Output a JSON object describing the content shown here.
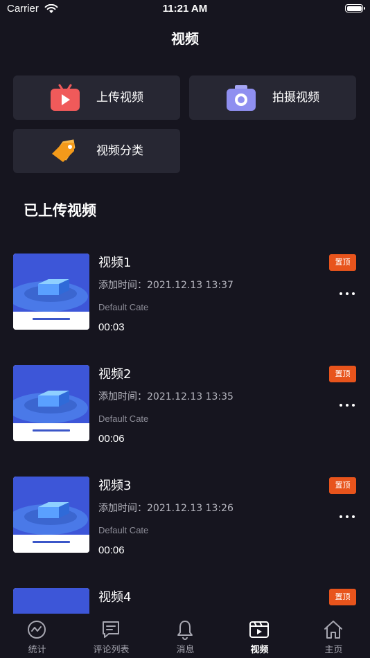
{
  "status_bar": {
    "carrier": "Carrier",
    "time": "11:21 AM",
    "wifi_icon": "wifi-icon",
    "battery_icon": "battery-icon"
  },
  "nav": {
    "title": "视频"
  },
  "actions": [
    {
      "label": "上传视频",
      "icon": "upload-video-icon",
      "color": "#f05a5a"
    },
    {
      "label": "拍摄视频",
      "icon": "camera-icon",
      "color": "#8f8ff0"
    },
    {
      "label": "视频分类",
      "icon": "tag-icon",
      "color": "#f5a623"
    }
  ],
  "section": {
    "title": "已上传视频"
  },
  "videos": [
    {
      "title": "视频1",
      "added": "添加时间：2021.12.13 13:37",
      "category": "Default Cate",
      "duration": "00:03",
      "badge": "置顶"
    },
    {
      "title": "视频2",
      "added": "添加时间：2021.12.13 13:35",
      "category": "Default Cate",
      "duration": "00:06",
      "badge": "置顶"
    },
    {
      "title": "视频3",
      "added": "添加时间：2021.12.13 13:26",
      "category": "Default Cate",
      "duration": "00:06",
      "badge": "置顶"
    },
    {
      "title": "视频4",
      "added": "",
      "category": "",
      "duration": "",
      "badge": "置顶"
    }
  ],
  "tabs": [
    {
      "label": "统计",
      "icon": "stats-icon",
      "active": false
    },
    {
      "label": "评论列表",
      "icon": "comment-icon",
      "active": false
    },
    {
      "label": "消息",
      "icon": "bell-icon",
      "active": false
    },
    {
      "label": "视频",
      "icon": "video-icon",
      "active": true
    },
    {
      "label": "主页",
      "icon": "home-icon",
      "active": false
    }
  ],
  "colors": {
    "background": "#16151f",
    "card": "#272733",
    "badge": "#e8541c"
  }
}
